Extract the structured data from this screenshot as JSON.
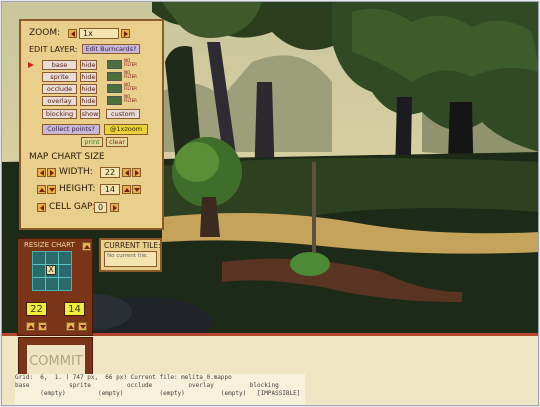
{
  "zoom": {
    "label": "ZOOM:",
    "value": "1x"
  },
  "edit_layer": {
    "label": "EDIT LAYER:",
    "burncards_button": "Edit Burncards?"
  },
  "layers": [
    {
      "name": "base",
      "hide_label": "hide",
      "selected": true
    },
    {
      "name": "sprite",
      "hide_label": "hide",
      "selected": false
    },
    {
      "name": "occlude",
      "hide_label": "hide",
      "selected": false
    },
    {
      "name": "overlay",
      "hide_label": "hide",
      "selected": false
    }
  ],
  "no_filter_label_1": "NO",
  "no_filter_label_2": "FILTER",
  "blocking": {
    "label": "blocking",
    "show_label": "show",
    "custom_label": "custom"
  },
  "collect_points_button": "Collect points?",
  "zoom_badge": "@1xzoom",
  "print_button": "print",
  "clear_button": "clear",
  "map_chart": {
    "title": "MAP CHART SIZE",
    "width_label": "WIDTH:",
    "width_value": "22",
    "height_label": "HEIGHT:",
    "height_value": "14",
    "cellgap_label": "CELL GAP:",
    "cellgap_value": "0"
  },
  "resize_chart": {
    "title": "RESIZE CHART",
    "width": "22",
    "height": "14",
    "center_mark": "X"
  },
  "commit_label": "COMMIT",
  "current_tile": {
    "title": "CURRENT TILE:",
    "value": "No current tile."
  },
  "status": {
    "line1": "Grid:  6,  1. ( 747 px,  66 px) Current file: melita_0.mappo",
    "line2": "base           sprite          occlude          overlay          blocking",
    "line3": "       (empty)         (empty)          (empty)          (empty)   [IMPASSIBLE]"
  },
  "colors": {
    "panel_bg": "#e9cf8c",
    "panel_border": "#8a5a2b",
    "resize_bg": "#7a3418",
    "accent_red": "#d61a1a"
  }
}
